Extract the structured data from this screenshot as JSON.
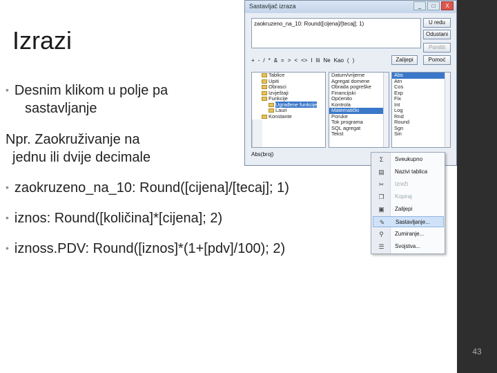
{
  "slide": {
    "title": "Izrazi",
    "bullets": [
      "Desnim klikom u polje pa",
      "sastavljanje",
      "Npr. Zaokruživanje na",
      "jednu ili dvije decimale",
      "zaokruzeno_na_10: Round([cijena]/[tecaj]; 1)",
      "iznos: Round([količina]*[cijena]; 2)",
      "iznoss.PDV: Round([iznos]*(1+[pdv]/100); 2)"
    ],
    "page_number": "43"
  },
  "dialog": {
    "title": "Sastavljač izraza",
    "expression": "zaokruzeno_na_10: Round([cijena]/[tecaj]; 1)",
    "buttons": [
      "U redu",
      "Odustani",
      "Poništi",
      "Pomoć"
    ],
    "operators": [
      "+",
      "-",
      "/",
      "*",
      "&",
      "=",
      ">",
      "<",
      "<>",
      "I",
      "Ili",
      "Ne",
      "Kao",
      "(",
      ")"
    ],
    "paste_label": "Zalijepi",
    "tree": [
      "Tablice",
      "Upiti",
      "Obrasci",
      "Izvještaji",
      "Funkcije",
      "Ugrađene funkcije",
      "Lauri",
      "Konstante"
    ],
    "categories": [
      "Datum/vrijeme",
      "Agregat domene",
      "Obrada pogreške",
      "Financijski",
      "Općenito",
      "Kontrola",
      "Matematički",
      "Poruke",
      "Tok programa",
      "SQL agregat",
      "Tekst"
    ],
    "functions": [
      "Abs",
      "Atn",
      "Cos",
      "Exp",
      "Fix",
      "Int",
      "Log",
      "Rnd",
      "Round",
      "Sgn",
      "Sin"
    ],
    "status": "Abs(broj)",
    "win_buttons": [
      "_",
      "□",
      "X"
    ]
  },
  "context_menu": {
    "items": [
      "Sveukupno",
      "Nazivi tablica",
      "Izreži",
      "Kopiraj",
      "Zalijepi",
      "Sastavljanje...",
      "Zumiranje...",
      "Svojstva..."
    ],
    "icons": [
      "sigma-icon",
      "table-names-icon",
      "cut-icon",
      "copy-icon",
      "paste-icon",
      "build-icon",
      "zoom-icon",
      "properties-icon"
    ]
  }
}
